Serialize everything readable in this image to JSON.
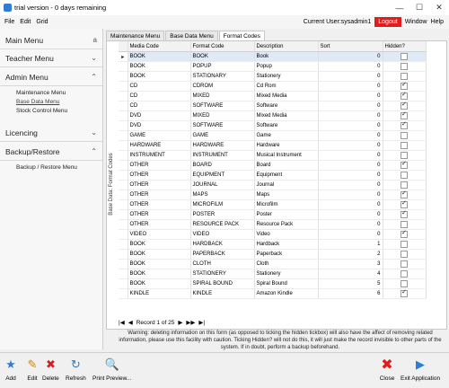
{
  "window": {
    "title": "trial version - 0 days remaining"
  },
  "menubar": {
    "items": [
      "File",
      "Edit",
      "Grid"
    ],
    "user": "Current User:sysadmin1",
    "logout": "Logout",
    "window": "Window",
    "help": "Help"
  },
  "sidebar": {
    "main_menu": "Main Menu",
    "main_badge": "a",
    "teacher_menu": "Teacher Menu",
    "admin_menu": "Admin Menu",
    "admin_items": [
      "Maintenance Menu",
      "Base Data Menu",
      "Stock Control Menu"
    ],
    "licencing": "Licencing",
    "backup": "Backup/Restore",
    "backup_items": [
      "Backup / Restore Menu"
    ]
  },
  "tabs": [
    "Maintenance Menu",
    "Base Data Menu",
    "Format Codes"
  ],
  "vertical_label": "Base Data: Format Codes",
  "grid": {
    "columns": [
      "Media Code",
      "Format Code",
      "Description",
      "Sort",
      "Hidden?"
    ],
    "rows": [
      [
        "BOOK",
        "BOOK",
        "Book",
        "0",
        false
      ],
      [
        "BOOK",
        "POPUP",
        "Popup",
        "0",
        false
      ],
      [
        "BOOK",
        "STATIONARY",
        "Stationery",
        "0",
        false
      ],
      [
        "CD",
        "CDROM",
        "Cd Rom",
        "0",
        true
      ],
      [
        "CD",
        "MIXED",
        "Mixed Media",
        "0",
        true
      ],
      [
        "CD",
        "SOFTWARE",
        "Software",
        "0",
        true
      ],
      [
        "DVD",
        "MIXED",
        "Mixed Media",
        "0",
        true
      ],
      [
        "DVD",
        "SOFTWARE",
        "Software",
        "0",
        true
      ],
      [
        "GAME",
        "GAME",
        "Game",
        "0",
        false
      ],
      [
        "HARDWARE",
        "HARDWARE",
        "Hardware",
        "0",
        false
      ],
      [
        "INSTRUMENT",
        "INSTRUMENT",
        "Musical Instrument",
        "0",
        false
      ],
      [
        "OTHER",
        "BOARD",
        "Board",
        "0",
        true
      ],
      [
        "OTHER",
        "EQUIPMENT",
        "Equipment",
        "0",
        false
      ],
      [
        "OTHER",
        "JOURNAL",
        "Journal",
        "0",
        false
      ],
      [
        "OTHER",
        "MAPS",
        "Maps",
        "0",
        true
      ],
      [
        "OTHER",
        "MICROFILM",
        "Microfilm",
        "0",
        true
      ],
      [
        "OTHER",
        "POSTER",
        "Poster",
        "0",
        true
      ],
      [
        "OTHER",
        "RESOURCE PACK",
        "Resource Pack",
        "0",
        false
      ],
      [
        "VIDEO",
        "VIDEO",
        "Video",
        "0",
        true
      ],
      [
        "BOOK",
        "HARDBACK",
        "Hardback",
        "1",
        false
      ],
      [
        "BOOK",
        "PAPERBACK",
        "Paperback",
        "2",
        false
      ],
      [
        "BOOK",
        "CLOTH",
        "Cloth",
        "3",
        false
      ],
      [
        "BOOK",
        "STATIONERY",
        "Stationery",
        "4",
        false
      ],
      [
        "BOOK",
        "SPIRAL BOUND",
        "Spiral Bound",
        "5",
        false
      ],
      [
        "KINDLE",
        "KINDLE",
        "Amazon Kindle",
        "6",
        true
      ]
    ]
  },
  "navigator": {
    "first": "|◀",
    "prev": "◀",
    "record": "Record 1 of 25",
    "next": "▶",
    "next_page": "▶▶",
    "last": "▶|"
  },
  "warning": "Warning: deleting information on this form (as opposed to ticking the hidden tickbox) will also have the affect of removing related information, please use this facility with caution. Ticking Hidden? will not do this, it will just make the record invisible to other parts of the system. If in doubt, perform a backup beforehand.",
  "toolbar": {
    "add": "Add",
    "edit": "Edit",
    "delete": "Delete",
    "refresh": "Refresh",
    "print": "Print Preview...",
    "close": "Close",
    "exit": "Exit Application"
  }
}
